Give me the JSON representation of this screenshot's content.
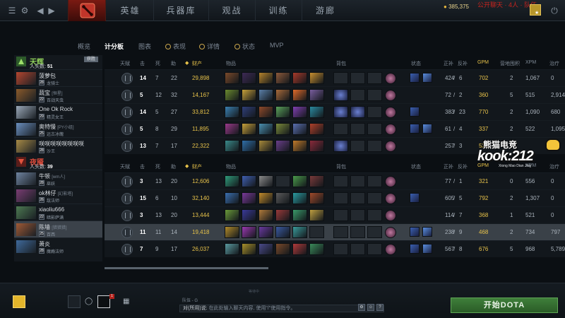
{
  "topnav": {
    "tabs": [
      "英雄",
      "兵器库",
      "观战",
      "训练",
      "游廊"
    ],
    "gold": "385,375",
    "red_text": "公开聊天 · 4人 · 队伍"
  },
  "subtabs": [
    {
      "label": "概览",
      "active": false,
      "coin": false
    },
    {
      "label": "计分板",
      "active": true,
      "coin": false
    },
    {
      "label": "图表",
      "active": false,
      "coin": false
    },
    {
      "label": "表现",
      "active": false,
      "coin": true
    },
    {
      "label": "详情",
      "active": false,
      "coin": true
    },
    {
      "label": "状态",
      "active": false,
      "coin": true
    },
    {
      "label": "MVP",
      "active": false,
      "coin": false
    }
  ],
  "radiant": {
    "name": "天辉",
    "kills_label": "人头数:",
    "kills": "51",
    "win_badge": "获胜",
    "color": "#8fcf5a",
    "players": [
      {
        "name": "菠萝包",
        "tag": "",
        "level": "28",
        "title": "龙骑士",
        "color": "#b5462f"
      },
      {
        "name": "蔬宝",
        "tag": "[恒星]",
        "level": "22",
        "title": "百战天虫",
        "color": "#8b5a2b"
      },
      {
        "name": "One Ok Rock",
        "tag": "",
        "level": "29",
        "title": "精灵女王",
        "color": "#9aa8b8"
      },
      {
        "name": "奥特慢",
        "tag": "[PY小组]",
        "level": "25",
        "title": "远古冰魄",
        "color": "#6a8fbf"
      },
      {
        "name": "咲咲咲咲咲咲咲咲",
        "tag": "",
        "level": "28",
        "title": "沙王",
        "color": "#a78a46"
      }
    ]
  },
  "dire": {
    "name": "夜魇",
    "kills_label": "人头数:",
    "kills": "39",
    "color": "#d84a3a",
    "players": [
      {
        "name": "牛顿",
        "tag": "[wm人]",
        "level": "28",
        "title": "巫妖",
        "color": "#6f84a0"
      },
      {
        "name": "ok林仔",
        "tag": "[幻影塔]",
        "level": "26",
        "title": "敌法师",
        "color": "#7a3d73"
      },
      {
        "name": "xiaoliu666",
        "tag": "",
        "level": "22",
        "title": "暗影萨满",
        "color": "#4d7a52"
      },
      {
        "name": "陈墙",
        "tag": "[猎猎猎]",
        "level": "25",
        "title": "百西",
        "color": "#a05a36"
      },
      {
        "name": "萧炎",
        "tag": "",
        "level": "28",
        "title": "魔瘾法师",
        "color": "#3f6a9c"
      }
    ]
  },
  "headers": {
    "talent": "天赋",
    "kills": "击",
    "deaths": "死",
    "assists": "助",
    "networth": "财产",
    "items": "物品",
    "backpack": "背包",
    "status": "状态",
    "lh": "正补",
    "dn": "反补",
    "gpm": "GPM",
    "stacks": "营地囤积",
    "xpm": "XPM",
    "heal": "治疗"
  },
  "radiant_rows": [
    {
      "k": "14",
      "d": "7",
      "a": "22",
      "nw": "29,898",
      "lh": "424",
      "dn": "6",
      "gpm": "702",
      "stk": "2",
      "xpm": "1,067",
      "heal": "0"
    },
    {
      "k": "5",
      "d": "12",
      "a": "32",
      "nw": "14,167",
      "lh": "72",
      "dn": "2",
      "gpm": "360",
      "stk": "5",
      "xpm": "515",
      "heal": "2,914"
    },
    {
      "k": "14",
      "d": "5",
      "a": "27",
      "nw": "33,812",
      "lh": "383",
      "dn": "23",
      "gpm": "770",
      "stk": "2",
      "xpm": "1,090",
      "heal": "680"
    },
    {
      "k": "5",
      "d": "8",
      "a": "29",
      "nw": "11,895",
      "lh": "61",
      "dn": "4",
      "gpm": "337",
      "stk": "2",
      "xpm": "522",
      "heal": "1,095"
    },
    {
      "k": "13",
      "d": "7",
      "a": "17",
      "nw": "22,322",
      "lh": "257",
      "dn": "3",
      "gpm": "529",
      "stk": "",
      "xpm": "",
      "heal": ""
    }
  ],
  "dire_rows": [
    {
      "k": "3",
      "d": "13",
      "a": "20",
      "nw": "12,606",
      "lh": "77",
      "dn": "1",
      "gpm": "321",
      "stk": "0",
      "xpm": "556",
      "heal": "0"
    },
    {
      "k": "15",
      "d": "6",
      "a": "10",
      "nw": "32,140",
      "lh": "605",
      "dn": "5",
      "gpm": "792",
      "stk": "2",
      "xpm": "1,307",
      "heal": "0"
    },
    {
      "k": "3",
      "d": "13",
      "a": "20",
      "nw": "13,444",
      "lh": "114",
      "dn": "7",
      "gpm": "368",
      "stk": "1",
      "xpm": "521",
      "heal": "0"
    },
    {
      "k": "11",
      "d": "11",
      "a": "14",
      "nw": "19,418",
      "lh": "238",
      "dn": "9",
      "gpm": "468",
      "stk": "2",
      "xpm": "734",
      "heal": "797"
    },
    {
      "k": "7",
      "d": "9",
      "a": "17",
      "nw": "26,037",
      "lh": "567",
      "dn": "8",
      "gpm": "676",
      "stk": "5",
      "xpm": "968",
      "heal": "5,789"
    }
  ],
  "watermark": {
    "line1": "熊猫电竞",
    "line2": "kook:212",
    "line3": "Xiong Mao Dian Jing"
  },
  "chat": {
    "channel": "队伍 - G",
    "label": "对(所用)说:",
    "placeholder": "在此处输入聊天内容, 使用\"/\"使用指令。"
  },
  "play_button": "开始DOTA",
  "notif_count": "1",
  "status_word": "等待中"
}
